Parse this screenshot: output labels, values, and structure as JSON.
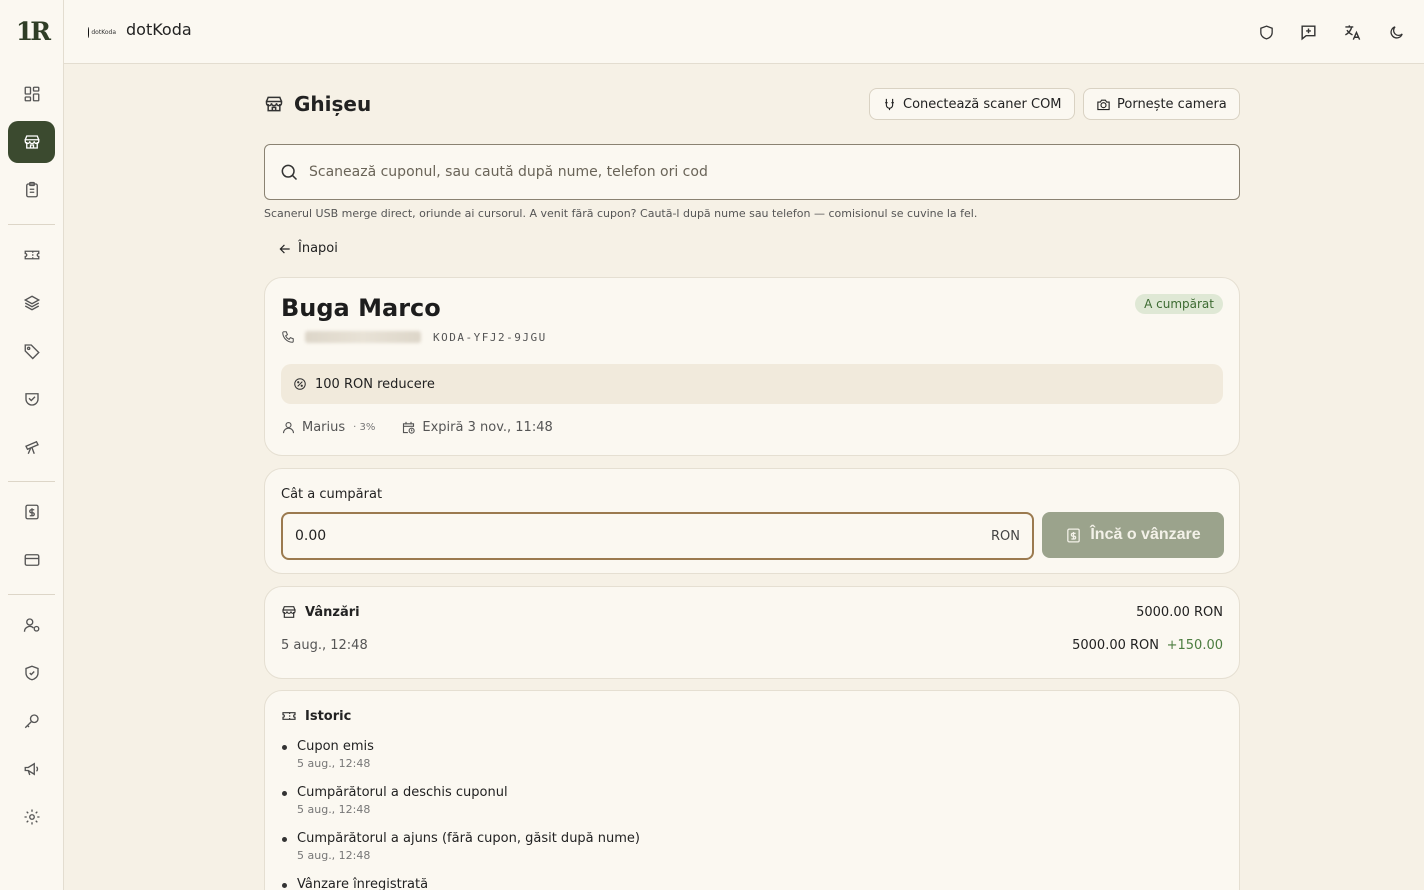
{
  "app": {
    "brand_name": "dotKoda",
    "logo_text": "1R",
    "brand_logo_text": "dotKoda"
  },
  "colors": {
    "accent": "#3b4a2f",
    "background": "#f6f1e6",
    "badge": "#dfe8d5",
    "commission": "#4c7d40",
    "disabled_button": "#9ba38c"
  },
  "sidebar": {
    "items": [
      {
        "icon": "dashboard-icon",
        "active": false
      },
      {
        "icon": "store-icon",
        "active": true
      },
      {
        "icon": "clipboard-icon",
        "active": false
      },
      {
        "icon": "ticket-icon",
        "active": false
      },
      {
        "icon": "layers-icon",
        "active": false
      },
      {
        "icon": "tag-icon",
        "active": false
      },
      {
        "icon": "handshake-icon",
        "active": false
      },
      {
        "icon": "telescope-icon",
        "active": false
      },
      {
        "icon": "receipt-icon",
        "active": false
      },
      {
        "icon": "credit-card-icon",
        "active": false
      },
      {
        "icon": "user-settings-icon",
        "active": false
      },
      {
        "icon": "shield-check-icon",
        "active": false
      },
      {
        "icon": "key-icon",
        "active": false
      },
      {
        "icon": "megaphone-icon",
        "active": false
      },
      {
        "icon": "gear-icon",
        "active": false
      }
    ]
  },
  "topbar": {
    "icons": [
      "shield-icon",
      "feedback-icon",
      "translate-icon",
      "moon-icon"
    ]
  },
  "page": {
    "title": "Ghișeu",
    "connect_scanner_label": "Conectează scaner COM",
    "start_camera_label": "Pornește camera",
    "search_placeholder": "Scanează cuponul, sau caută după nume, telefon ori cod",
    "hint": "Scanerul USB merge direct, oriunde ai cursorul. A venit fără cupon? Caută-l după nume sau telefon — comisionul se cuvine la fel.",
    "back_label": "Înapoi"
  },
  "customer": {
    "name": "Buga Marco",
    "status": "A cumpărat",
    "code": "KODA-YFJ2-9JGU",
    "discount": "100 RON reducere",
    "agent": "Marius",
    "agent_pct": "· 3%",
    "expires": "Expiră 3 nov., 11:48"
  },
  "purchase": {
    "label": "Cât a cumpărat",
    "value": "0.00",
    "unit": "RON",
    "button_label": "Încă o vânzare"
  },
  "sales": {
    "title": "Vânzări",
    "total": "5000.00 RON",
    "rows": [
      {
        "date": "5 aug., 12:48",
        "amount": "5000.00 RON",
        "commission": "+150.00"
      }
    ]
  },
  "history": {
    "title": "Istoric",
    "items": [
      {
        "label": "Cupon emis",
        "date": "5 aug., 12:48"
      },
      {
        "label": "Cumpărătorul a deschis cuponul",
        "date": "5 aug., 12:48"
      },
      {
        "label": "Cumpărătorul a ajuns (fără cupon, găsit după nume)",
        "date": "5 aug., 12:48"
      },
      {
        "label": "Vânzare înregistrată",
        "date": ""
      }
    ]
  }
}
